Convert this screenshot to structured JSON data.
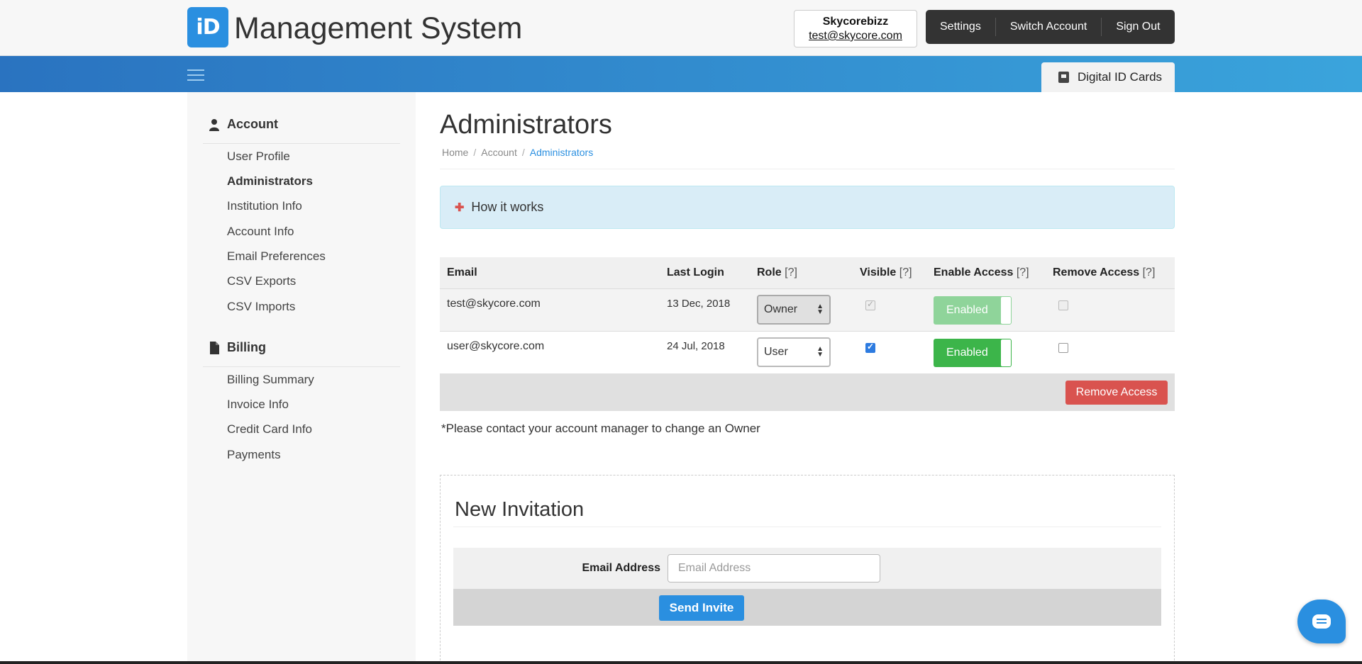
{
  "header": {
    "logo_text": "iD",
    "app_title": "Management System",
    "account_name": "Skycorebizz",
    "account_email": "test@skycore.com",
    "nav": [
      "Settings",
      "Switch Account",
      "Sign Out"
    ],
    "tab_card": "Digital ID Cards"
  },
  "sidebar": {
    "account_title": "Account",
    "account_items": [
      "User Profile",
      "Administrators",
      "Institution Info",
      "Account Info",
      "Email Preferences",
      "CSV Exports",
      "CSV Imports"
    ],
    "active_item": "Administrators",
    "billing_title": "Billing",
    "billing_items": [
      "Billing Summary",
      "Invoice Info",
      "Credit Card Info",
      "Payments"
    ]
  },
  "main": {
    "title": "Administrators",
    "breadcrumb": [
      "Home",
      "Account",
      "Administrators"
    ],
    "how_it_works": "How it works",
    "table": {
      "headers": {
        "email": "Email",
        "last_login": "Last Login",
        "role": "Role",
        "visible": "Visible",
        "enable_access": "Enable Access",
        "remove_access": "Remove Access",
        "help": "[?]"
      },
      "rows": [
        {
          "email": "test@skycore.com",
          "last_login": "13 Dec, 2018",
          "role": "Owner",
          "visible": true,
          "enable": "Enabled",
          "remove": false,
          "disabled": true
        },
        {
          "email": "user@skycore.com",
          "last_login": "24 Jul, 2018",
          "role": "User",
          "visible": true,
          "enable": "Enabled",
          "remove": false,
          "disabled": false
        }
      ]
    },
    "remove_button": "Remove Access",
    "owner_note": "*Please contact your account manager to change an Owner",
    "invitation": {
      "title": "New Invitation",
      "email_label": "Email Address",
      "email_placeholder": "Email Address",
      "email_value": "",
      "send_button": "Send Invite"
    }
  },
  "colors": {
    "brand_blue": "#2a8fe0",
    "danger_red": "#d9534f",
    "enabled_green": "#3cb54a",
    "nav_dark": "#333333"
  }
}
